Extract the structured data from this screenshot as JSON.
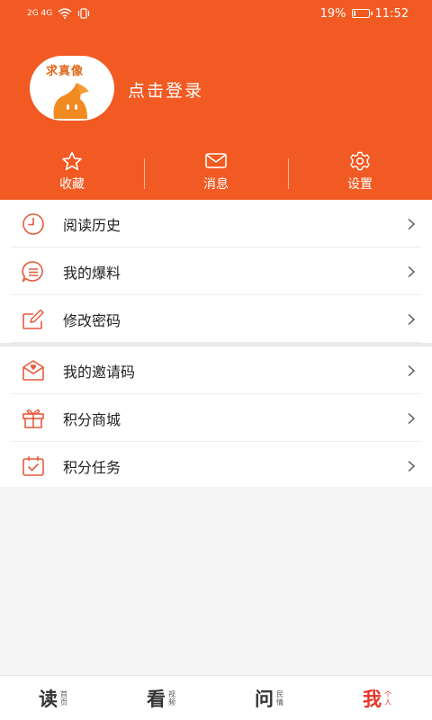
{
  "status": {
    "net": "2G  4G",
    "battery": "19%",
    "battery_fraction": 0.19,
    "time": "11:52"
  },
  "profile": {
    "avatar_text": "求真像",
    "login_label": "点击登录"
  },
  "quick_actions": [
    {
      "label": "收藏",
      "icon": "star-icon"
    },
    {
      "label": "消息",
      "icon": "envelope-icon"
    },
    {
      "label": "设置",
      "icon": "gear-icon"
    }
  ],
  "menu_group1": [
    {
      "label": "阅读历史",
      "icon": "clock-icon"
    },
    {
      "label": "我的爆料",
      "icon": "chat-bubble-icon"
    },
    {
      "label": "修改密码",
      "icon": "edit-icon"
    }
  ],
  "menu_group2": [
    {
      "label": "我的邀请码",
      "icon": "invite-icon"
    },
    {
      "label": "积分商城",
      "icon": "gift-icon"
    },
    {
      "label": "积分任务",
      "icon": "calendar-check-icon"
    }
  ],
  "tabs": [
    {
      "main": "读",
      "sub": "首页"
    },
    {
      "main": "看",
      "sub": "视频"
    },
    {
      "main": "问",
      "sub": "民情"
    },
    {
      "main": "我",
      "sub": "个人"
    }
  ],
  "colors": {
    "brand": "#f15a22",
    "icon_accent": "#e65a3c",
    "active_tab": "#e8352a"
  }
}
